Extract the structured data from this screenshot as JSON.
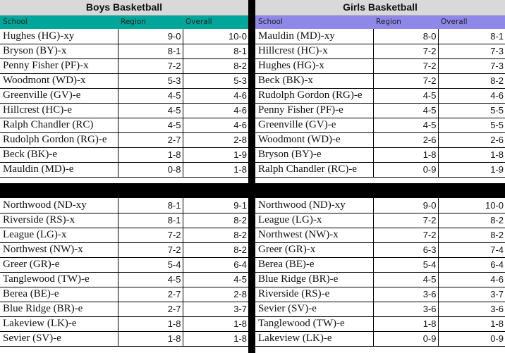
{
  "boys": {
    "title": "Boys Basketball",
    "header_color": "#00a699",
    "columns": [
      "School",
      "Region",
      "Overall"
    ],
    "division1": [
      [
        "Hughes (HG)-xy",
        "9-0",
        "10-0"
      ],
      [
        "Bryson (BY)-x",
        "8-1",
        "8-1"
      ],
      [
        "Penny Fisher (PF)-x",
        "7-2",
        "8-2"
      ],
      [
        "Woodmont (WD)-x",
        "5-3",
        "5-3"
      ],
      [
        "Greenville (GV)-e",
        "4-5",
        "4-6"
      ],
      [
        "Hillcrest (HC)-e",
        "4-5",
        "4-6"
      ],
      [
        "Ralph Chandler (RC)",
        "4-5",
        "4-6"
      ],
      [
        "Rudolph Gordon (RG)-e",
        "2-7",
        "2-8"
      ],
      [
        "Beck (BK)-e",
        "1-8",
        "1-9"
      ],
      [
        "Mauldin (MD)-e",
        "0-8",
        "1-8"
      ]
    ],
    "division2": [
      [
        "Northwood (ND-xy",
        "8-1",
        "9-1"
      ],
      [
        "Riverside (RS)-x",
        "8-1",
        "8-2"
      ],
      [
        "League (LG)-x",
        "7-2",
        "8-2"
      ],
      [
        "Northwest (NW)-x",
        "7-2",
        "8-2"
      ],
      [
        "Greer (GR)-e",
        "5-4",
        "6-4"
      ],
      [
        "Tanglewood (TW)-e",
        "4-5",
        "4-5"
      ],
      [
        "Berea (BE)-e",
        "2-7",
        "2-8"
      ],
      [
        "Blue Ridge (BR)-e",
        "2-7",
        "3-7"
      ],
      [
        "Lakeview (LK)-e",
        "1-8",
        "1-8"
      ],
      [
        "Sevier (SV)-e",
        "1-8",
        "1-8"
      ]
    ]
  },
  "girls": {
    "title": "Girls Basketball",
    "header_color": "#8f88e8",
    "columns": [
      "School",
      "Region",
      "Overall"
    ],
    "division1": [
      [
        "Mauldin (MD)-xy",
        "8-0",
        "8-1"
      ],
      [
        "Hillcrest (HC)-x",
        "7-2",
        "7-3"
      ],
      [
        "Hughes (HG)-x",
        "7-2",
        "7-3"
      ],
      [
        "Beck (BK)-x",
        "7-2",
        "8-2"
      ],
      [
        "Rudolph Gordon (RG)-e",
        "4-5",
        "4-6"
      ],
      [
        "Penny Fisher (PF)-e",
        "4-5",
        "5-5"
      ],
      [
        "Greenville (GV)-e",
        "4-5",
        "5-5"
      ],
      [
        "Woodmont (WD)-e",
        "2-6",
        "2-6"
      ],
      [
        "Bryson (BY)-e",
        "1-8",
        "1-8"
      ],
      [
        "Ralph Chandler (RC)-e",
        "0-9",
        "1-9"
      ]
    ],
    "division2": [
      [
        "Northwood (ND)-xy",
        "9-0",
        "10-0"
      ],
      [
        "League (LG)-x",
        "7-2",
        "8-2"
      ],
      [
        "Northwest (NW)-x",
        "7-2",
        "8-2"
      ],
      [
        "Greer (GR)-x",
        "6-3",
        "7-4"
      ],
      [
        "Berea (BE)-e",
        "5-4",
        "6-4"
      ],
      [
        "Blue Ridge (BR)-e",
        "4-5",
        "4-6"
      ],
      [
        "Riverside (RS)-e",
        "3-6",
        "3-7"
      ],
      [
        "Sevier (SV)-e",
        "3-6",
        "3-6"
      ],
      [
        "Tanglewood (TW)-e",
        "1-8",
        "1-8"
      ],
      [
        "Lakeview (LK)-e",
        "0-9",
        "0-9"
      ]
    ]
  }
}
